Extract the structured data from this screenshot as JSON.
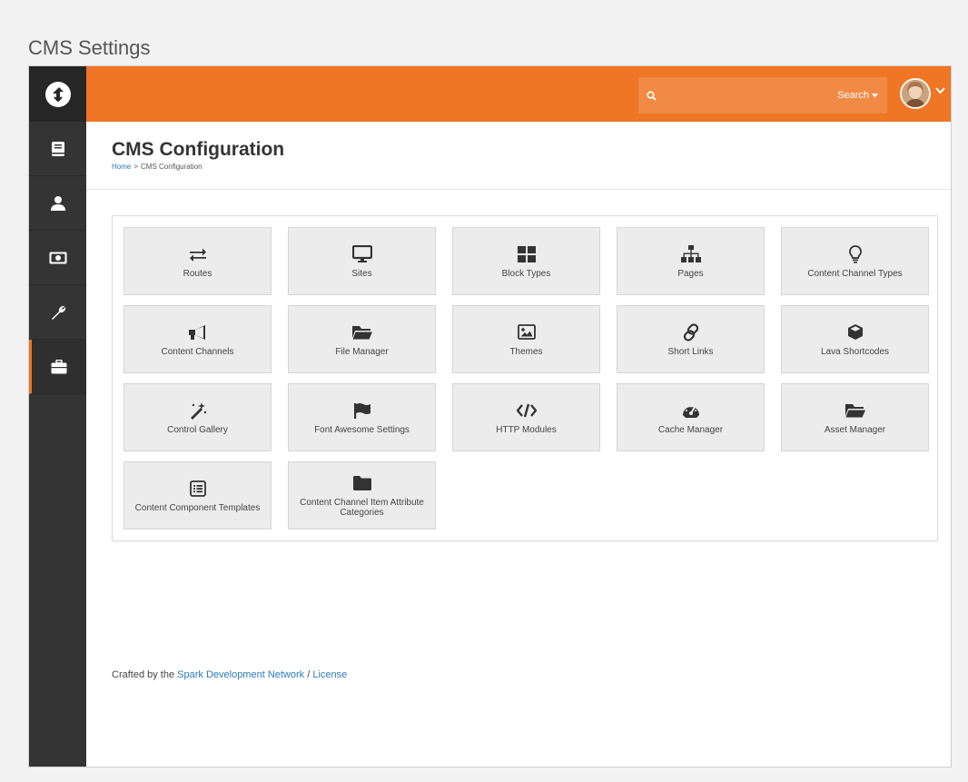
{
  "doc_title": "CMS Settings",
  "search": {
    "placeholder": "",
    "label": "Search"
  },
  "header": {
    "title": "CMS Configuration",
    "breadcrumb": {
      "home": "Home",
      "separator": ">",
      "current": "CMS Configuration"
    }
  },
  "tiles": [
    {
      "label": "Routes",
      "icon": "exchange-icon"
    },
    {
      "label": "Sites",
      "icon": "desktop-icon"
    },
    {
      "label": "Block Types",
      "icon": "th-large-icon"
    },
    {
      "label": "Pages",
      "icon": "sitemap-icon"
    },
    {
      "label": "Content Channel Types",
      "icon": "lightbulb-icon"
    },
    {
      "label": "Content Channels",
      "icon": "bullhorn-icon"
    },
    {
      "label": "File Manager",
      "icon": "folder-open-icon"
    },
    {
      "label": "Themes",
      "icon": "image-icon"
    },
    {
      "label": "Short Links",
      "icon": "link-icon"
    },
    {
      "label": "Lava Shortcodes",
      "icon": "cube-icon"
    },
    {
      "label": "Control Gallery",
      "icon": "magic-icon"
    },
    {
      "label": "Font Awesome Settings",
      "icon": "flag-icon"
    },
    {
      "label": "HTTP Modules",
      "icon": "code-icon"
    },
    {
      "label": "Cache Manager",
      "icon": "tachometer-icon"
    },
    {
      "label": "Asset Manager",
      "icon": "folder-open-icon"
    },
    {
      "label": "Content Component Templates",
      "icon": "list-alt-icon"
    },
    {
      "label": "Content Channel Item Attribute Categories",
      "icon": "folder-icon"
    }
  ],
  "footer": {
    "prefix": "Crafted by the",
    "link1": "Spark Development Network",
    "separator": "/",
    "link2": "License"
  },
  "colors": {
    "accent": "#ee7624",
    "sidebar": "#343434",
    "link": "#2b7bb9"
  }
}
